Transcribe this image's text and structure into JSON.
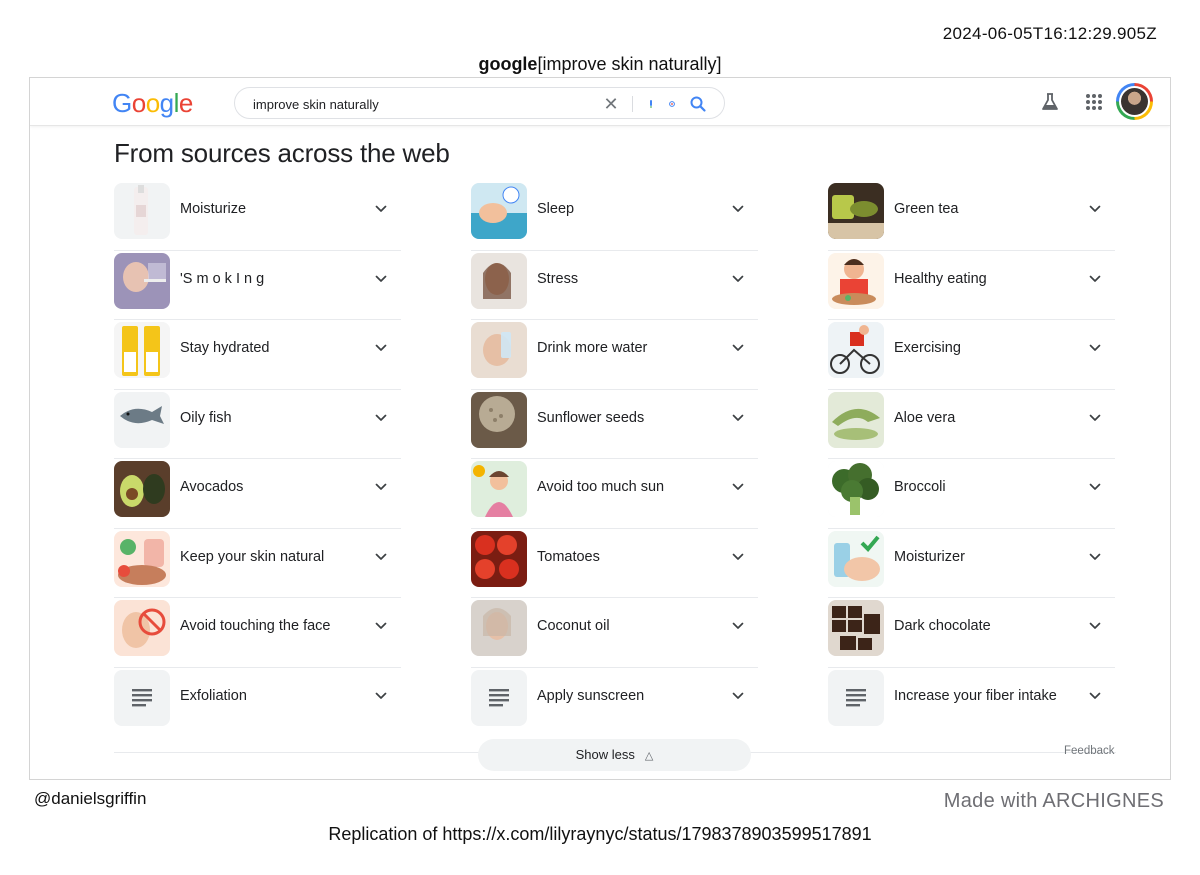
{
  "timestamp": "2024-06-05T16:12:29.905Z",
  "caption": {
    "engine": "google",
    "query_bracketed": "[improve skin naturally]"
  },
  "header": {
    "logo": [
      "G",
      "o",
      "o",
      "g",
      "l",
      "e"
    ],
    "search_value": "improve skin naturally",
    "icons": [
      "clear-icon",
      "mic-icon",
      "lens-icon",
      "search-icon",
      "labs-flask-icon",
      "apps-grid-icon",
      "avatar"
    ]
  },
  "section_title": "From sources across the web",
  "columns": [
    [
      {
        "label": "Moisturize",
        "thumb": "moisturizer-bottle-photo"
      },
      {
        "label": "'S m o k I n g",
        "thumb": "smoking-photo"
      },
      {
        "label": "Stay hydrated",
        "thumb": "sunscreen-tubes-photo"
      },
      {
        "label": "Oily fish",
        "thumb": "fish-photo"
      },
      {
        "label": "Avocados",
        "thumb": "avocado-photo"
      },
      {
        "label": "Keep your skin natural",
        "thumb": "natural-skin-illustration"
      },
      {
        "label": "Avoid touching the face",
        "thumb": "no-touch-illustration"
      },
      {
        "label": "Exfoliation",
        "thumb": "article-icon"
      }
    ],
    [
      {
        "label": "Sleep",
        "thumb": "sleep-illustration"
      },
      {
        "label": "Stress",
        "thumb": "woman-portrait-photo"
      },
      {
        "label": "Drink more water",
        "thumb": "drinking-water-photo"
      },
      {
        "label": "Sunflower seeds",
        "thumb": "seeds-photo"
      },
      {
        "label": "Avoid too much sun",
        "thumb": "sun-illustration"
      },
      {
        "label": "Tomatoes",
        "thumb": "tomatoes-photo"
      },
      {
        "label": "Coconut oil",
        "thumb": "coconut-oil-photo"
      },
      {
        "label": "Apply sunscreen",
        "thumb": "article-icon"
      }
    ],
    [
      {
        "label": "Green tea",
        "thumb": "green-tea-photo"
      },
      {
        "label": "Healthy eating",
        "thumb": "healthy-eating-illustration"
      },
      {
        "label": "Exercising",
        "thumb": "cycling-illustration"
      },
      {
        "label": "Aloe vera",
        "thumb": "aloe-vera-photo"
      },
      {
        "label": "Broccoli",
        "thumb": "broccoli-photo"
      },
      {
        "label": "Moisturizer",
        "thumb": "moisturizer-illustration"
      },
      {
        "label": "Dark chocolate",
        "thumb": "chocolate-photo"
      },
      {
        "label": "Increase your fiber intake",
        "thumb": "article-icon"
      }
    ]
  ],
  "show_less_label": "Show less",
  "feedback_label": "Feedback",
  "footer": {
    "handle": "@danielsgriffin",
    "made_with": "Made with ARCHIGNES",
    "replication": "Replication of https://x.com/lilyraynyc/status/1798378903599517891"
  },
  "colors": {
    "google_blue": "#4285f4",
    "google_red": "#ea4335",
    "google_yellow": "#fbbc05",
    "google_green": "#34a853",
    "text": "#202124",
    "muted": "#70757a",
    "divider": "#e8eaed",
    "pill_bg": "#f1f3f4"
  }
}
